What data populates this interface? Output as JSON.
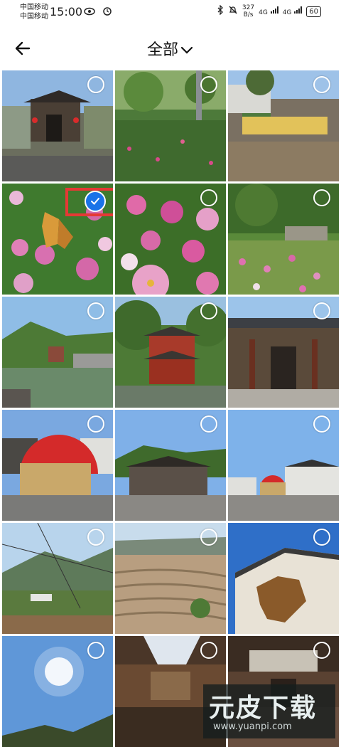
{
  "status_bar": {
    "carrier1": "中国移动",
    "carrier2": "中国移动",
    "time": "15:00",
    "speed_value": "327",
    "speed_unit": "B/s",
    "signal1": "4G",
    "signal2": "4G",
    "battery": "60",
    "icons": [
      "eye-icon",
      "alarm-icon",
      "bluetooth-icon",
      "mute-bell-icon",
      "signal-icon",
      "battery-icon"
    ]
  },
  "header": {
    "title": "全部",
    "back_icon": "arrow-left-icon",
    "dropdown_icon": "chevron-down-icon"
  },
  "grid": {
    "photos": [
      {
        "name": "photo-village-gate",
        "selected": false
      },
      {
        "name": "photo-green-field",
        "selected": false
      },
      {
        "name": "photo-yellow-sign",
        "selected": false
      },
      {
        "name": "photo-butterfly-flowers",
        "selected": true
      },
      {
        "name": "photo-cosmos-flowers",
        "selected": false
      },
      {
        "name": "photo-flower-field",
        "selected": false
      },
      {
        "name": "photo-pond-pavilion",
        "selected": false
      },
      {
        "name": "photo-red-pavilion",
        "selected": false
      },
      {
        "name": "photo-ancient-hall",
        "selected": false
      },
      {
        "name": "photo-red-arch",
        "selected": false
      },
      {
        "name": "photo-village-square",
        "selected": false
      },
      {
        "name": "photo-village-street",
        "selected": false
      },
      {
        "name": "photo-mountain-valley",
        "selected": false
      },
      {
        "name": "photo-terraces",
        "selected": false
      },
      {
        "name": "photo-map-wall",
        "selected": false
      },
      {
        "name": "photo-sun-sky",
        "selected": false
      },
      {
        "name": "photo-courtyard-1",
        "selected": false
      },
      {
        "name": "photo-courtyard-2",
        "selected": false
      }
    ]
  },
  "watermark": {
    "title": "元皮下载",
    "url": "www.yuanpi.com"
  },
  "colors": {
    "accent": "#1a73e8",
    "highlight": "#e53935"
  }
}
